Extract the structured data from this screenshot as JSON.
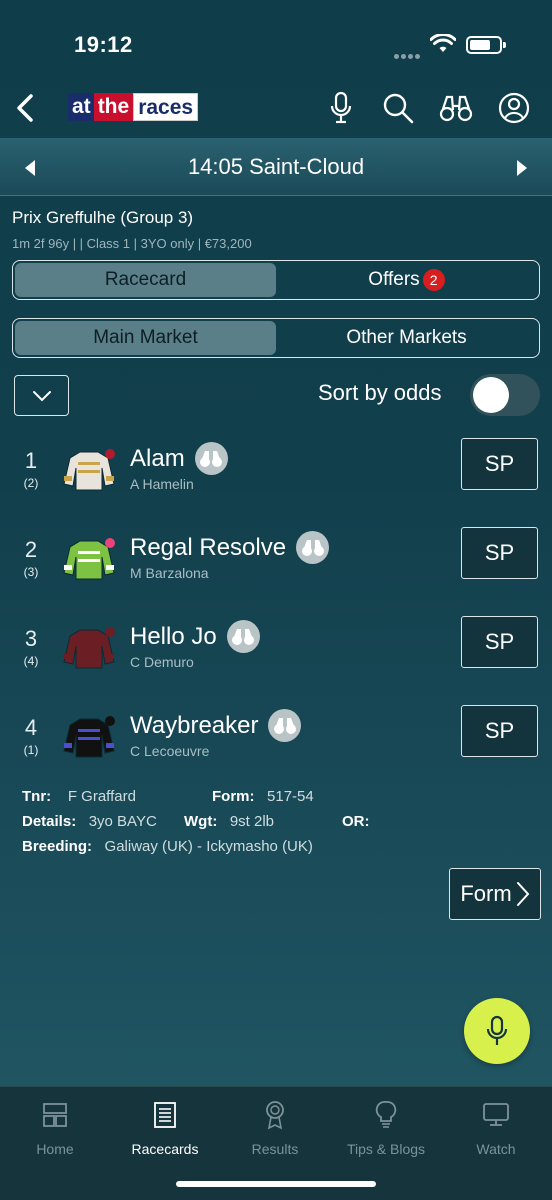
{
  "status_bar": {
    "time": "19:12"
  },
  "header": {
    "logo": {
      "part1": "at",
      "part2": "the",
      "part3": "races"
    },
    "icons": [
      "microphone-icon",
      "search-icon",
      "binoculars-icon",
      "account-icon"
    ]
  },
  "race": {
    "selector_title": "14:05 Saint-Cloud",
    "name": "Prix Greffulhe (Group 3)",
    "meta": "1m 2f 96y |  | Class 1 | 3YO only | €73,200"
  },
  "tabs": {
    "racecard": "Racecard",
    "offers": "Offers",
    "offers_badge": "2"
  },
  "markets": {
    "main": "Main Market",
    "other": "Other Markets"
  },
  "sort": {
    "label": "Sort by odds",
    "enabled": false
  },
  "runners": [
    {
      "number": "1",
      "draw": "(2)",
      "horse": "Alam",
      "jockey": "A Hamelin",
      "price": "SP",
      "silk_colors": [
        "#e8e4dc",
        "#c9a54a",
        "#b01c2e"
      ]
    },
    {
      "number": "2",
      "draw": "(3)",
      "horse": "Regal Resolve",
      "jockey": "M Barzalona",
      "price": "SP",
      "silk_colors": [
        "#7dc242",
        "#ffffff",
        "#e8447a"
      ]
    },
    {
      "number": "3",
      "draw": "(4)",
      "horse": "Hello Jo",
      "jockey": "C Demuro",
      "price": "SP",
      "silk_colors": [
        "#6b1f24",
        "#6b1f24",
        "#6b1f24"
      ]
    },
    {
      "number": "4",
      "draw": "(1)",
      "horse": "Waybreaker",
      "jockey": "C Lecoeuvre",
      "price": "SP",
      "silk_colors": [
        "#111111",
        "#4a4fcf",
        "#111111"
      ]
    }
  ],
  "details": {
    "trainer_label": "Tnr:",
    "trainer": "F Graffard",
    "form_label": "Form:",
    "form": "517-54",
    "details_label": "Details:",
    "details": "3yo BAYC",
    "weight_label": "Wgt:",
    "weight": "9st 2lb",
    "or_label": "OR:",
    "or": "",
    "breeding_label": "Breeding:",
    "breeding": "Galiway (UK) - Ickymasho (UK)"
  },
  "form_button": "Form",
  "bottom_nav": [
    {
      "label": "Home",
      "icon": "home-icon",
      "active": false
    },
    {
      "label": "Racecards",
      "icon": "racecard-icon",
      "active": true
    },
    {
      "label": "Results",
      "icon": "results-icon",
      "active": false
    },
    {
      "label": "Tips & Blogs",
      "icon": "lightbulb-icon",
      "active": false
    },
    {
      "label": "Watch",
      "icon": "tv-icon",
      "active": false
    }
  ],
  "colors": {
    "accent": "#d8f04c",
    "badge": "#d71f1f",
    "background": "#123f4c"
  }
}
